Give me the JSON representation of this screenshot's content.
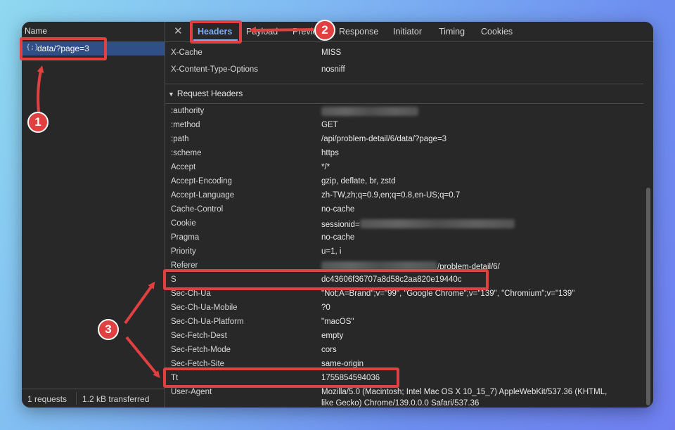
{
  "left_pane": {
    "name_header": "Name",
    "request": {
      "icon": "json-icon",
      "icon_glyph": "{;}",
      "label": "data/?page=3"
    },
    "status": {
      "requests": "1 requests",
      "transferred": "1.2 kB transferred"
    }
  },
  "tabs": {
    "close_glyph": "✕",
    "items": [
      "Headers",
      "Payload",
      "Preview",
      "Response",
      "Initiator",
      "Timing",
      "Cookies"
    ],
    "active": "Headers"
  },
  "response_headers_tail": [
    {
      "name": "X-Cache",
      "value": "MISS"
    },
    {
      "name": "X-Content-Type-Options",
      "value": "nosniff"
    }
  ],
  "request_headers": {
    "title": "Request Headers",
    "rows": [
      {
        "name": ":authority",
        "value": ""
      },
      {
        "name": ":method",
        "value": "GET"
      },
      {
        "name": ":path",
        "value": "/api/problem-detail/6/data/?page=3"
      },
      {
        "name": ":scheme",
        "value": "https"
      },
      {
        "name": "Accept",
        "value": "*/*"
      },
      {
        "name": "Accept-Encoding",
        "value": "gzip, deflate, br, zstd"
      },
      {
        "name": "Accept-Language",
        "value": "zh-TW,zh;q=0.9,en;q=0.8,en-US;q=0.7"
      },
      {
        "name": "Cache-Control",
        "value": "no-cache"
      },
      {
        "name": "Cookie",
        "value": "sessionid="
      },
      {
        "name": "Pragma",
        "value": "no-cache"
      },
      {
        "name": "Priority",
        "value": "u=1, i"
      },
      {
        "name": "Referer",
        "value": "/problem-detail/6/"
      },
      {
        "name": "S",
        "value": "dc43606f36707a8d58c2aa820e19440c"
      },
      {
        "name": "Sec-Ch-Ua",
        "value": "\"Not;A=Brand\";v=\"99\", \"Google Chrome\";v=\"139\", \"Chromium\";v=\"139\""
      },
      {
        "name": "Sec-Ch-Ua-Mobile",
        "value": "?0"
      },
      {
        "name": "Sec-Ch-Ua-Platform",
        "value": "\"macOS\""
      },
      {
        "name": "Sec-Fetch-Dest",
        "value": "empty"
      },
      {
        "name": "Sec-Fetch-Mode",
        "value": "cors"
      },
      {
        "name": "Sec-Fetch-Site",
        "value": "same-origin"
      },
      {
        "name": "Tt",
        "value": "1755854594036"
      },
      {
        "name": "User-Agent",
        "value": "Mozilla/5.0 (Macintosh; Intel Mac OS X 10_15_7) AppleWebKit/537.36 (KHTML,"
      },
      {
        "name": "",
        "value": "like Gecko) Chrome/139.0.0.0 Safari/537.36"
      }
    ]
  },
  "annotations": {
    "badges": [
      "1",
      "2",
      "3"
    ],
    "color": "#e0403f"
  },
  "colors": {
    "panel": "#282828",
    "selected_row": "#2f4f86",
    "active_tab": "#7cacf8"
  }
}
